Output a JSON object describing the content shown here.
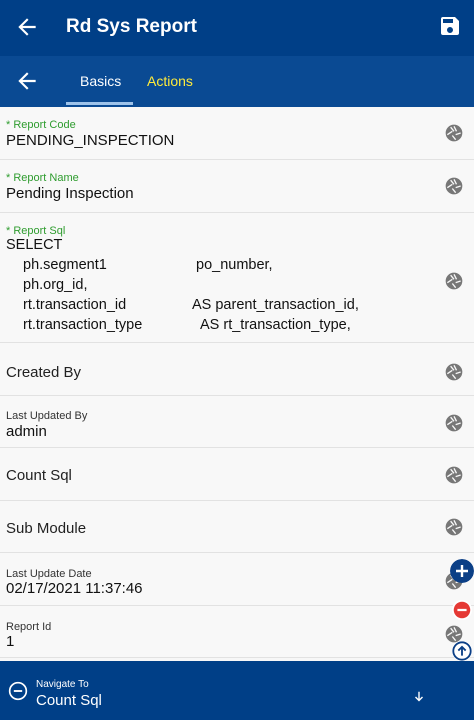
{
  "header": {
    "title": "Rd Sys Report"
  },
  "tabs": {
    "basics": "Basics",
    "actions": "Actions"
  },
  "fields": {
    "report_code": {
      "label": "* Report Code",
      "value": "PENDING_INSPECTION"
    },
    "report_name": {
      "label": "* Report Name",
      "value": "Pending Inspection"
    },
    "report_sql": {
      "label": "* Report Sql",
      "lines": {
        "l0": "SELECT",
        "l1a": "ph.segment1",
        "l1b": "po_number,",
        "l2a": "ph.org_id,",
        "l3a": "rt.transaction_id",
        "l3b": "AS parent_transaction_id,",
        "l4a": "rt.transaction_type",
        "l4b": "AS rt_transaction_type,"
      }
    },
    "created_by": {
      "label": "Created By"
    },
    "last_updated_by": {
      "label": "Last Updated By",
      "value": "admin"
    },
    "count_sql": {
      "label": "Count Sql"
    },
    "sub_module": {
      "label": "Sub Module"
    },
    "last_update_date": {
      "label": "Last Update Date",
      "value": "02/17/2021 11:37:46"
    },
    "report_id": {
      "label": "Report Id",
      "value": "1"
    }
  },
  "navigate": {
    "label": "Navigate To",
    "value": "Count Sql"
  },
  "colors": {
    "header": "#003f87",
    "tabbar": "#0a4a93",
    "required_label": "#2e9c2e",
    "active_tab_text": "#ffffff",
    "inactive_tab_text": "#ffeb3b",
    "fab_add": "#0b3f86",
    "fab_remove": "#e53935"
  }
}
